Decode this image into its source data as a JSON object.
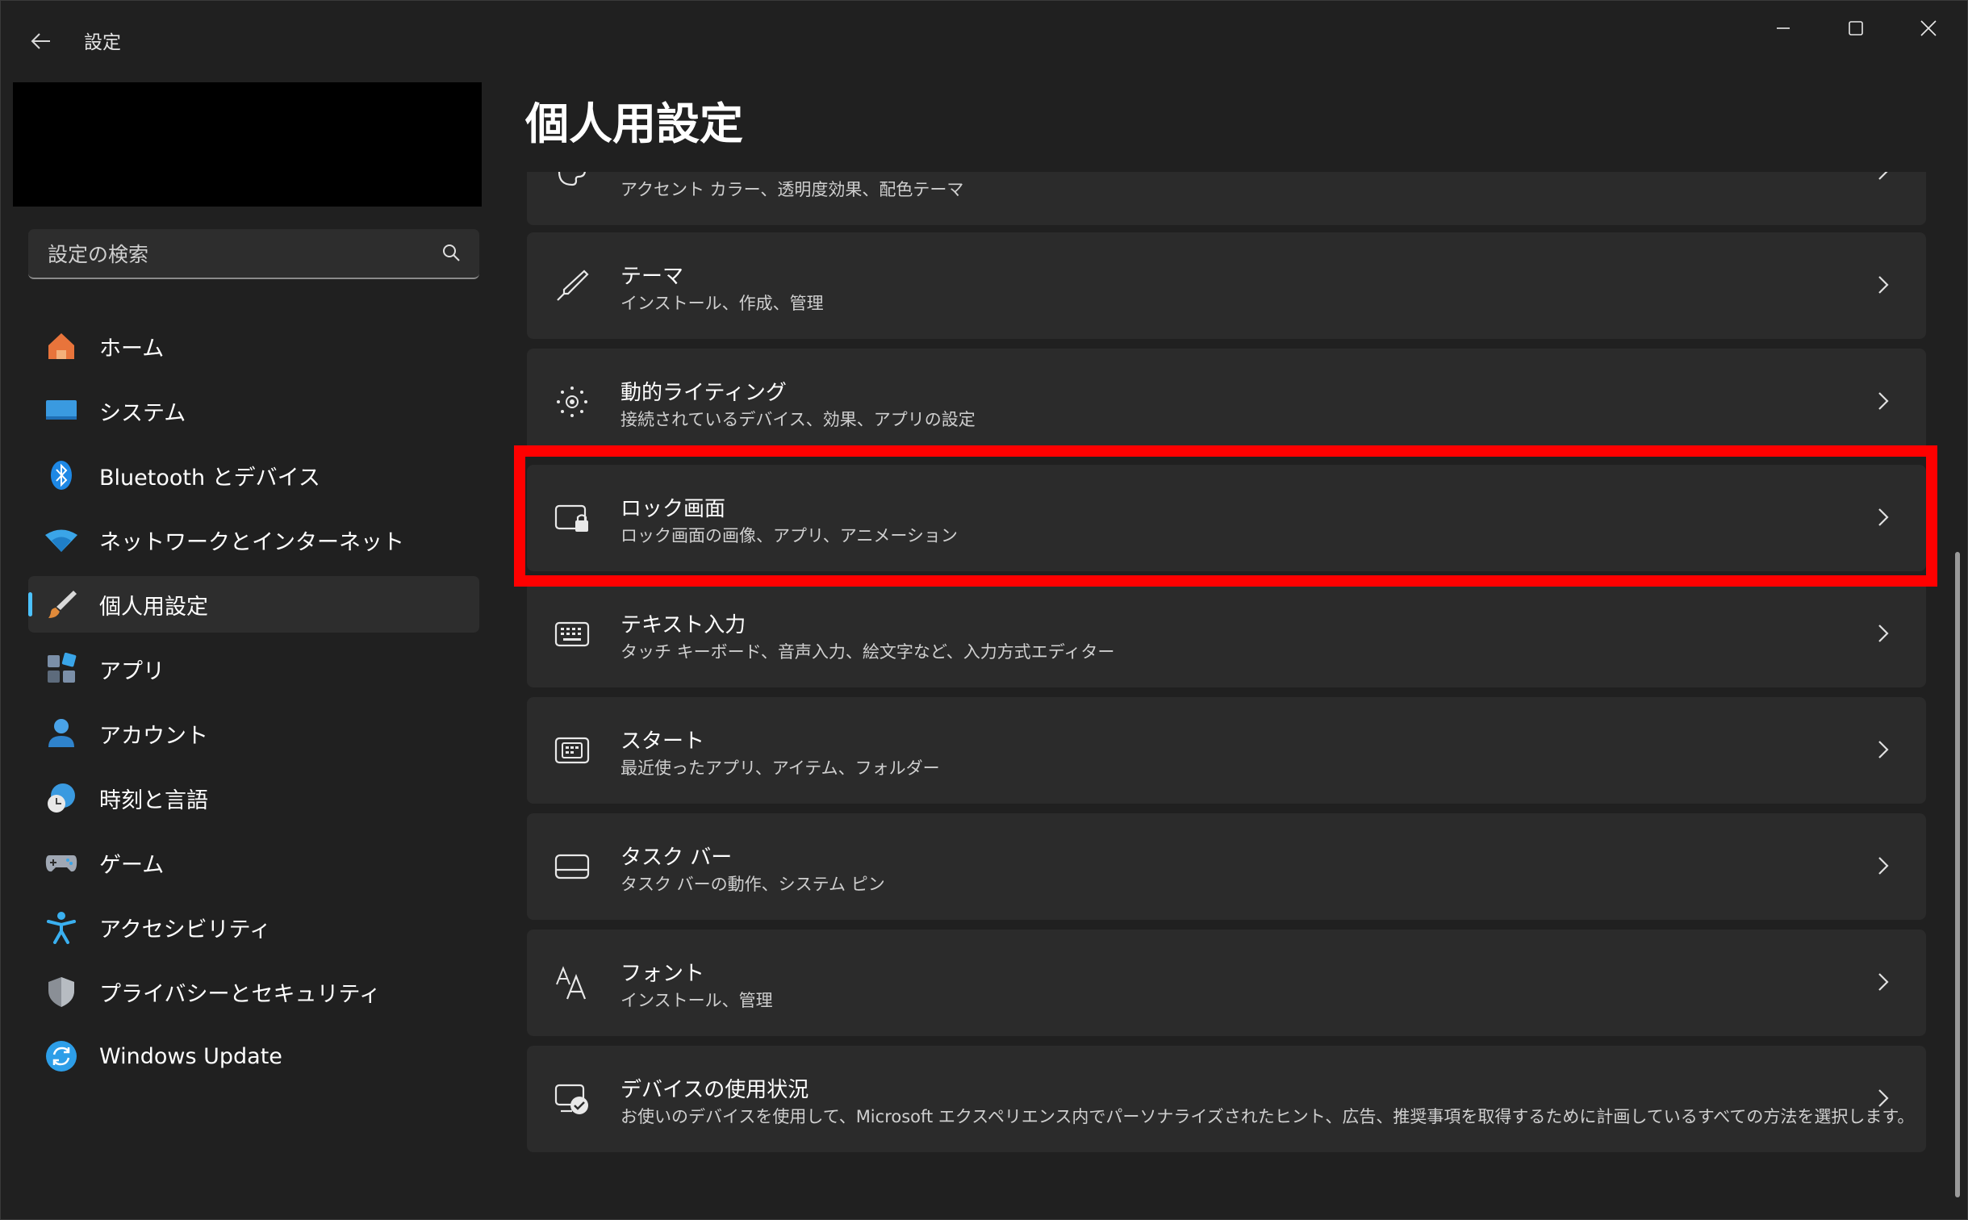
{
  "window": {
    "title": "設定",
    "controls": {
      "minimize": "minimize-icon",
      "maximize": "maximize-icon",
      "close": "close-icon"
    }
  },
  "search": {
    "placeholder": "設定の検索"
  },
  "sidebar": {
    "items": [
      {
        "label": "ホーム",
        "icon": "home-icon",
        "color": "#e8743b"
      },
      {
        "label": "システム",
        "icon": "monitor-icon",
        "color": "#3a9ae0"
      },
      {
        "label": "Bluetooth とデバイス",
        "icon": "bluetooth-icon",
        "color": "#1e88e5"
      },
      {
        "label": "ネットワークとインターネット",
        "icon": "wifi-icon",
        "color": "#3aa5e8"
      },
      {
        "label": "個人用設定",
        "icon": "brush-icon",
        "color": "#e08a3a",
        "selected": true
      },
      {
        "label": "アプリ",
        "icon": "apps-icon",
        "color": "#7b8fa8"
      },
      {
        "label": "アカウント",
        "icon": "person-icon",
        "color": "#4aa3e8"
      },
      {
        "label": "時刻と言語",
        "icon": "clock-globe-icon",
        "color": "#3a9ae0"
      },
      {
        "label": "ゲーム",
        "icon": "gamepad-icon",
        "color": "#a0a8b4"
      },
      {
        "label": "アクセシビリティ",
        "icon": "accessibility-icon",
        "color": "#3ab0f0"
      },
      {
        "label": "プライバシーとセキュリティ",
        "icon": "shield-icon",
        "color": "#8a8f96"
      },
      {
        "label": "Windows Update",
        "icon": "update-icon",
        "color": "#2d9ee8"
      }
    ]
  },
  "main": {
    "title": "個人用設定",
    "cards": [
      {
        "title": "",
        "subtitle": "アクセント カラー、透明度効果、配色テーマ",
        "icon": "palette-icon"
      },
      {
        "title": "テーマ",
        "subtitle": "インストール、作成、管理",
        "icon": "pen-icon"
      },
      {
        "title": "動的ライティング",
        "subtitle": "接続されているデバイス、効果、アプリの設定",
        "icon": "lighting-icon"
      },
      {
        "title": "ロック画面",
        "subtitle": "ロック画面の画像、アプリ、アニメーション",
        "icon": "lock-screen-icon"
      },
      {
        "title": "テキスト入力",
        "subtitle": "タッチ キーボード、音声入力、絵文字など、入力方式エディター",
        "icon": "keyboard-icon"
      },
      {
        "title": "スタート",
        "subtitle": "最近使ったアプリ、アイテム、フォルダー",
        "icon": "start-icon"
      },
      {
        "title": "タスク バー",
        "subtitle": "タスク バーの動作、システム ピン",
        "icon": "taskbar-icon"
      },
      {
        "title": "フォント",
        "subtitle": "インストール、管理",
        "icon": "font-icon"
      },
      {
        "title": "デバイスの使用状況",
        "subtitle": "お使いのデバイスを使用して、Microsoft エクスペリエンス内でパーソナライズされたヒント、広告、推奨事項を取得するために計画しているすべての方法を選択します。",
        "icon": "device-usage-icon"
      }
    ]
  },
  "colors": {
    "accent": "#4cc2ff",
    "highlight": "#ff0000",
    "background": "#202020",
    "card": "#2b2b2b"
  }
}
